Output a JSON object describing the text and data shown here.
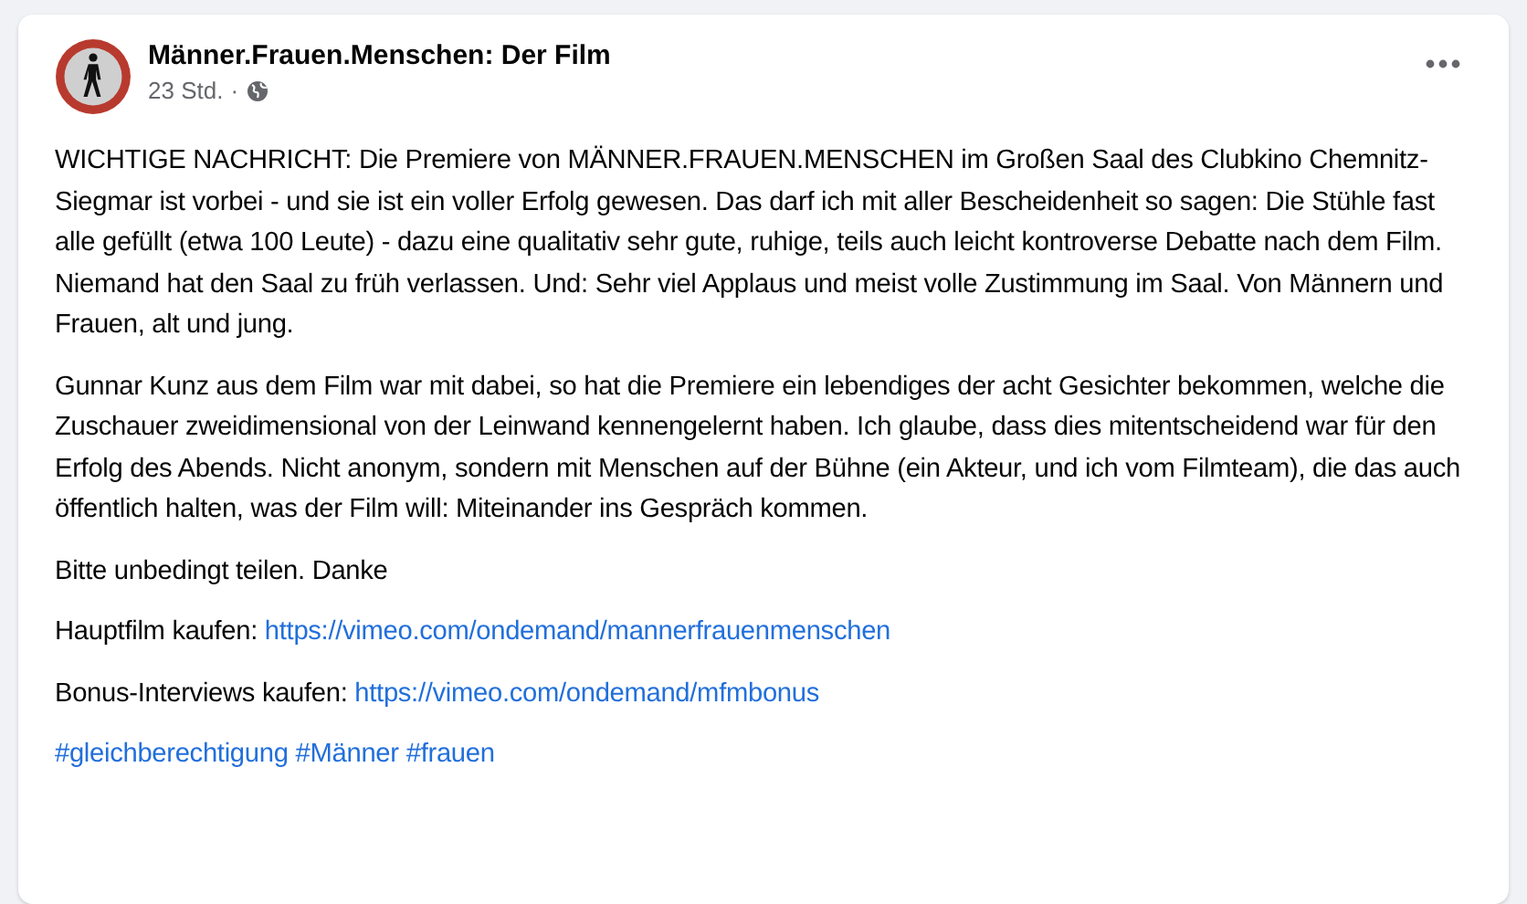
{
  "post": {
    "author": "Männer.Frauen.Menschen: Der Film",
    "time": "23 Std.",
    "separator": "·",
    "paragraphs": [
      {
        "kind": "text",
        "text": "WICHTIGE NACHRICHT: Die Premiere von MÄNNER.FRAUEN.MENSCHEN im Großen Saal des Clubkino Chemnitz-Siegmar ist vorbei - und sie ist ein voller Erfolg gewesen. Das darf ich mit aller Bescheidenheit so sagen: Die Stühle fast alle gefüllt (etwa 100 Leute) - dazu eine qualitativ sehr gute, ruhige, teils auch leicht kontroverse Debatte nach dem Film. Niemand hat den Saal zu früh verlassen. Und: Sehr viel Applaus und meist volle Zustimmung im Saal. Von Männern und Frauen, alt und jung."
      },
      {
        "kind": "text",
        "text": "Gunnar Kunz aus dem Film war mit dabei, so hat die Premiere ein lebendiges der acht Gesichter bekommen, welche die Zuschauer zweidimensional von der Leinwand kennengelernt haben. Ich glaube, dass dies mitentscheidend war für den Erfolg des Abends. Nicht anonym, sondern mit Menschen auf der Bühne (ein Akteur, und ich vom Filmteam), die das auch öffentlich halten, was der Film will: Miteinander ins Gespräch kommen."
      },
      {
        "kind": "text",
        "text": "Bitte unbedingt teilen. Danke"
      },
      {
        "kind": "link",
        "text": "Hauptfilm kaufen: ",
        "link": "https://vimeo.com/ondemand/mannerfrauenmenschen"
      },
      {
        "kind": "link",
        "text": "Bonus-Interviews kaufen: ",
        "link": "https://vimeo.com/ondemand/mfmbonus"
      }
    ],
    "hashtags": [
      "#gleichberechtigung",
      "#Männer",
      "#frauen"
    ]
  }
}
